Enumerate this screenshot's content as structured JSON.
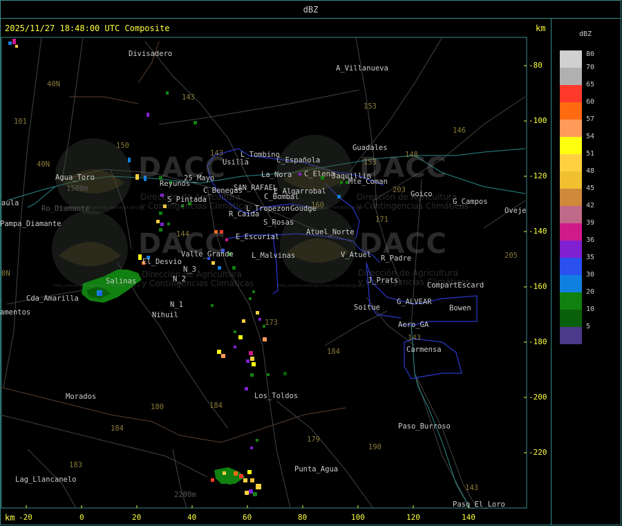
{
  "window": {
    "title": "dBZ"
  },
  "header": {
    "datetime": "2025/11/27 18:48:00 UTC Composite",
    "unit": "km"
  },
  "axes": {
    "unit_bottom": "km",
    "x_ticks": [
      "-20",
      "0",
      "20",
      "40",
      "60",
      "80",
      "100",
      "120",
      "140"
    ],
    "y_ticks": [
      "-80",
      "-100",
      "-120",
      "-140",
      "-160",
      "-180",
      "-200",
      "-220"
    ]
  },
  "legend": {
    "title": "dBZ",
    "items": [
      {
        "label": "80",
        "color": "#d0d0d0"
      },
      {
        "label": "70",
        "color": "#b0b0b0"
      },
      {
        "label": "65",
        "color": "#ff3a2a"
      },
      {
        "label": "60",
        "color": "#ff6a10"
      },
      {
        "label": "57",
        "color": "#ff9a5a"
      },
      {
        "label": "54",
        "color": "#ffff10"
      },
      {
        "label": "51",
        "color": "#ffd040"
      },
      {
        "label": "48",
        "color": "#f0c030"
      },
      {
        "label": "45",
        "color": "#d0883a"
      },
      {
        "label": "42",
        "color": "#c06a8a"
      },
      {
        "label": "39",
        "color": "#d01a8a"
      },
      {
        "label": "36",
        "color": "#8020d0"
      },
      {
        "label": "35",
        "color": "#2a50f0"
      },
      {
        "label": "30",
        "color": "#1080e0"
      },
      {
        "label": "20",
        "color": "#108010"
      },
      {
        "label": "10",
        "color": "#0a600a"
      },
      {
        "label": "5",
        "color": "#4a3a8a"
      }
    ]
  },
  "places": [
    {
      "id": "divisadero",
      "label": "Divisadero"
    },
    {
      "id": "a-villanueva",
      "label": "A_Villanueva"
    },
    {
      "id": "guadales",
      "label": "Guadales"
    },
    {
      "id": "tombino",
      "label": "L_Tombino"
    },
    {
      "id": "usilla",
      "label": "Usilla"
    },
    {
      "id": "c-espanola",
      "label": "C_Española"
    },
    {
      "id": "la-nora",
      "label": "La_Nora"
    },
    {
      "id": "c-elena",
      "label": "C_Elena"
    },
    {
      "id": "cuadro-benegas",
      "label": "C_Benegas"
    },
    {
      "id": "san-rafael",
      "label": "SAN_RAFAEL"
    },
    {
      "id": "algarrobal",
      "label": "E_Algarrobal"
    },
    {
      "id": "c-bombal",
      "label": "C_Bombal"
    },
    {
      "id": "trope",
      "label": "L_Tropezon"
    },
    {
      "id": "goudge",
      "label": "Goudge"
    },
    {
      "id": "monte-coman",
      "label": "Mte_Coman"
    },
    {
      "id": "jaquillin",
      "label": "Jaquillin"
    },
    {
      "id": "goico",
      "label": "Goico"
    },
    {
      "id": "g-campos",
      "label": "G_Campos"
    },
    {
      "id": "oveje",
      "label": "Oveje"
    },
    {
      "id": "agua-toro",
      "label": "Agua_Toro"
    },
    {
      "id": "reyunos",
      "label": "Reyunos"
    },
    {
      "id": "mayo",
      "label": "25_Mayo"
    },
    {
      "id": "s-pintada",
      "label": "S_Pintada"
    },
    {
      "id": "r-caida",
      "label": "R_Caida"
    },
    {
      "id": "s-rosas",
      "label": "S_Rosas"
    },
    {
      "id": "atuel-norte",
      "label": "Atuel_Norte"
    },
    {
      "id": "e-escurial",
      "label": "E_Escurial"
    },
    {
      "id": "laula",
      "label": "aula"
    },
    {
      "id": "pampa-diamante",
      "label": "Pampa_Diamante"
    },
    {
      "id": "valle-grande",
      "label": "Valle_Grande"
    },
    {
      "id": "l-malvinas",
      "label": "L_Malvinas"
    },
    {
      "id": "v-atuel",
      "label": "V_Atuel"
    },
    {
      "id": "r-padre",
      "label": "R_Padre"
    },
    {
      "id": "el-desvio",
      "label": "El_Desvio"
    },
    {
      "id": "salinas",
      "label": "Salinas"
    },
    {
      "id": "n-2",
      "label": "N_2"
    },
    {
      "id": "n-3",
      "label": "N_3"
    },
    {
      "id": "n-1",
      "label": "N_1"
    },
    {
      "id": "nihuil",
      "label": "Nihuil"
    },
    {
      "id": "j-prats",
      "label": "J_Prats"
    },
    {
      "id": "compart",
      "label": "CompartEscard"
    },
    {
      "id": "g-alvear",
      "label": "G_ALVEAR"
    },
    {
      "id": "soitue",
      "label": "Soitue"
    },
    {
      "id": "bowen",
      "label": "Bowen"
    },
    {
      "id": "aero-ga",
      "label": "Aero_GA"
    },
    {
      "id": "carmensa",
      "label": "Carmensa"
    },
    {
      "id": "cda-amarilla",
      "label": "Cda_Amarilla"
    },
    {
      "id": "amentos",
      "label": "amentos"
    },
    {
      "id": "morados",
      "label": "Morados"
    },
    {
      "id": "los-toldos",
      "label": "Los_Toldos"
    },
    {
      "id": "paso-burroso",
      "label": "Paso_Burroso"
    },
    {
      "id": "punta-agua",
      "label": "Punta_Agua"
    },
    {
      "id": "lag-llancanelo",
      "label": "Lag_Llancanelo"
    },
    {
      "id": "paso-loro",
      "label": "Paso_El_Loro"
    },
    {
      "id": "ro-diamante",
      "label": "Ro_Diamante"
    },
    {
      "id": "m1500",
      "label": "1500m"
    },
    {
      "id": "m2200",
      "label": "2200m"
    },
    {
      "id": "n40n",
      "label": "40N"
    },
    {
      "id": "n40n2",
      "label": "40N"
    },
    {
      "id": "n0n",
      "label": "0N"
    }
  ],
  "route_numbers": [
    "101",
    "143",
    "153",
    "146",
    "148",
    "153",
    "203",
    "150",
    "143",
    "171",
    "144",
    "160",
    "173",
    "184",
    "180",
    "184",
    "179",
    "190",
    "183",
    "184",
    "143",
    "205",
    "143"
  ],
  "watermark": {
    "logo": "DACC",
    "line1": "Dirección de Agricultura",
    "line2": "y Contingencias Climáticas",
    "url": "http://www.contingencias.mendoza.gov.ar"
  }
}
